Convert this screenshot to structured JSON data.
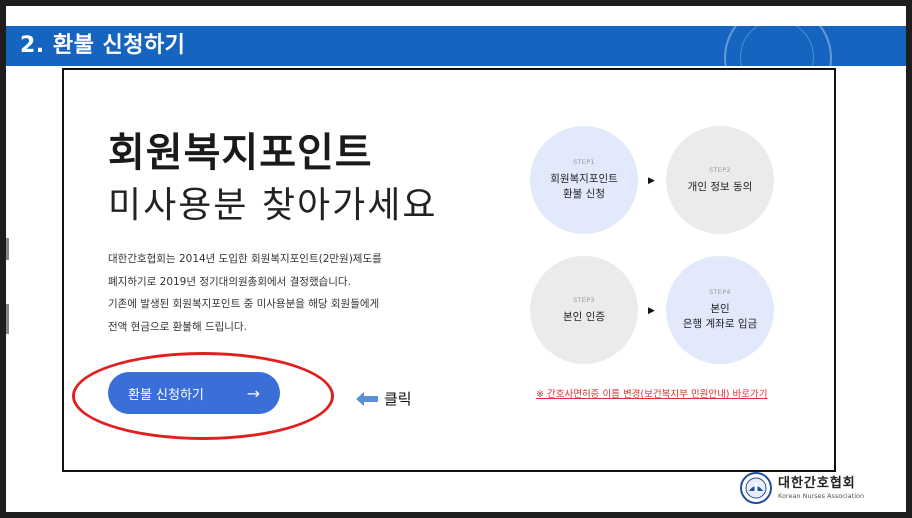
{
  "header": {
    "title": "2. 환불 신청하기"
  },
  "hero": {
    "title": "회원복지포인트",
    "subtitle": "미사용분 찾아가세요",
    "description": [
      "대한간호협회는 2014년 도입한 회원복지포인트(2만원)제도를",
      "폐지하기로 2019년 정기대의원총회에서 결정했습니다.",
      "기존에 발생된 회원복지포인트 중 미사용분을 해당 회원들에게",
      "전액 현금으로 환불해 드립니다."
    ],
    "apply_button": {
      "label": "환불 신청하기",
      "arrow": "→"
    }
  },
  "annotation": {
    "click_label": "클릭"
  },
  "steps": [
    {
      "num": "STEP1",
      "line1": "회원복지포인트",
      "line2": "환불 신청",
      "color": "#e1e9fb"
    },
    {
      "num": "STEP2",
      "line1": "개인 정보 동의",
      "line2": "",
      "color": "#ebebeb"
    },
    {
      "num": "STEP3",
      "line1": "본인 인증",
      "line2": "",
      "color": "#ebebeb"
    },
    {
      "num": "STEP4",
      "line1": "본인",
      "line2": "은행 계좌로 입금",
      "color": "#e1e9fb"
    }
  ],
  "step_arrow": "▶",
  "link": {
    "text": "※ 간호사면허증 이름 변경(보건복지부 민원안내) 바로가기"
  },
  "footer": {
    "logo_ko": "대한간호협회",
    "logo_en": "Korean Nurses Association"
  },
  "colors": {
    "header_bg": "#1565c0",
    "button_bg": "#3a6fd8",
    "highlight_ring": "#e02020",
    "link": "#e03030"
  }
}
